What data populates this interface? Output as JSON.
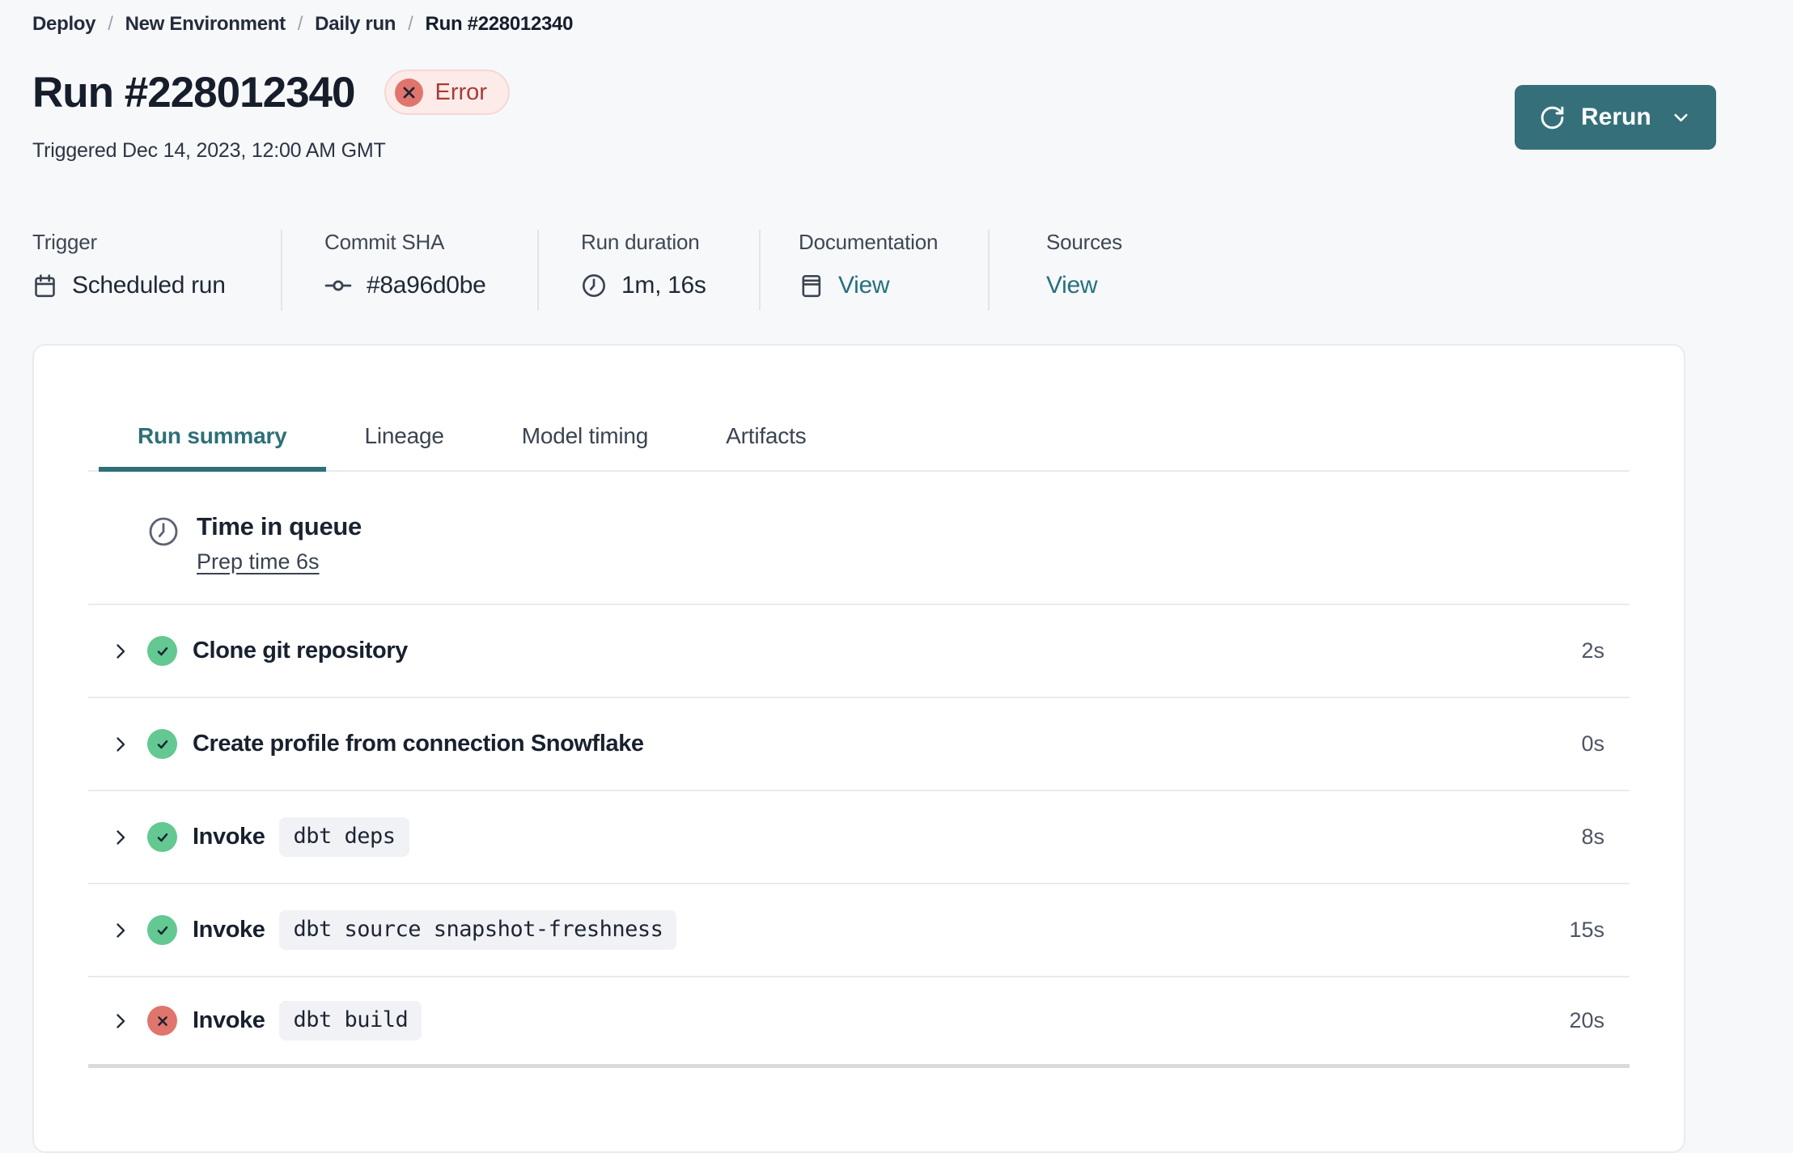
{
  "breadcrumb": {
    "separator": "/",
    "items": [
      "Deploy",
      "New Environment",
      "Daily run",
      "Run #228012340"
    ]
  },
  "header": {
    "title": "Run #228012340",
    "status_badge": {
      "label": "Error"
    },
    "triggered": "Triggered Dec 14, 2023, 12:00 AM GMT",
    "rerun_label": "Rerun"
  },
  "metadata": {
    "columns": [
      {
        "label": "Trigger",
        "value": "Scheduled run",
        "icon": "calendar-icon"
      },
      {
        "label": "Commit SHA",
        "value": "#8a96d0be",
        "icon": "commit-icon"
      },
      {
        "label": "Run duration",
        "value": "1m, 16s",
        "icon": "clock-icon"
      },
      {
        "label": "Documentation",
        "value": "View",
        "icon": "document-icon",
        "is_link": true
      },
      {
        "label": "Sources",
        "value": "View",
        "is_link": true
      }
    ]
  },
  "tabs": [
    {
      "label": "Run summary",
      "active": true
    },
    {
      "label": "Lineage",
      "active": false
    },
    {
      "label": "Model timing",
      "active": false
    },
    {
      "label": "Artifacts",
      "active": false
    }
  ],
  "run_summary": {
    "queue": {
      "title": "Time in queue",
      "prep_link": "Prep time 6s",
      "icon": "clock-icon"
    },
    "steps": [
      {
        "title": "Clone git repository",
        "status": "success",
        "duration": "2s"
      },
      {
        "title": "Create profile from connection Snowflake",
        "status": "success",
        "duration": "0s"
      },
      {
        "title": "Invoke",
        "command": "dbt deps",
        "status": "success",
        "duration": "8s"
      },
      {
        "title": "Invoke",
        "command": "dbt source snapshot-freshness",
        "status": "success",
        "duration": "15s"
      },
      {
        "title": "Invoke",
        "command": "dbt build",
        "status": "error",
        "duration": "20s"
      }
    ]
  },
  "icons": {
    "status_success": "check",
    "status_error": "x",
    "rerun": "rotate-cw",
    "rerun_menu": "chevron-down",
    "step_expand": "chevron-right"
  },
  "colors": {
    "page_bg": "#f7f8fa",
    "accent_teal": "#2e7077",
    "button_teal": "#35707a",
    "success_green": "#63c891",
    "error_red": "#e0756d",
    "error_badge_bg": "#fcebe9",
    "error_badge_text": "#a93b37",
    "text_dark": "#161d2b"
  }
}
